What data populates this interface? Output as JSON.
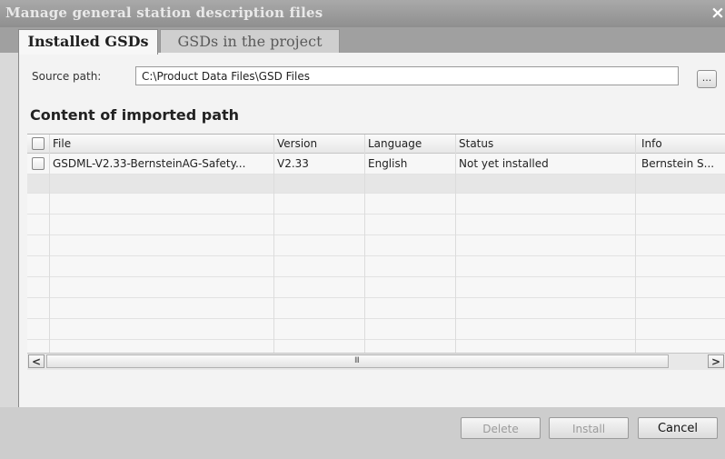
{
  "window": {
    "title": "Manage general station description files",
    "close_glyph": "×"
  },
  "tabs": [
    {
      "label": "Installed GSDs",
      "active": true
    },
    {
      "label": "GSDs in the project",
      "active": false
    }
  ],
  "source": {
    "label": "Source path:",
    "value": "C:\\Product Data Files\\GSD Files",
    "browse_label": "..."
  },
  "content": {
    "title": "Content of imported path",
    "columns": [
      "File",
      "Version",
      "Language",
      "Status",
      "Info"
    ],
    "rows": [
      {
        "file": "GSDML-V2.33-BernsteinAG-Safety...",
        "version": "V2.33",
        "language": "English",
        "status": "Not yet installed",
        "info": "Bernstein S..."
      }
    ]
  },
  "scrollbar": {
    "left_glyph": "<",
    "right_glyph": ">",
    "grip": "III"
  },
  "buttons": {
    "delete": "Delete",
    "install": "Install",
    "cancel": "Cancel"
  }
}
